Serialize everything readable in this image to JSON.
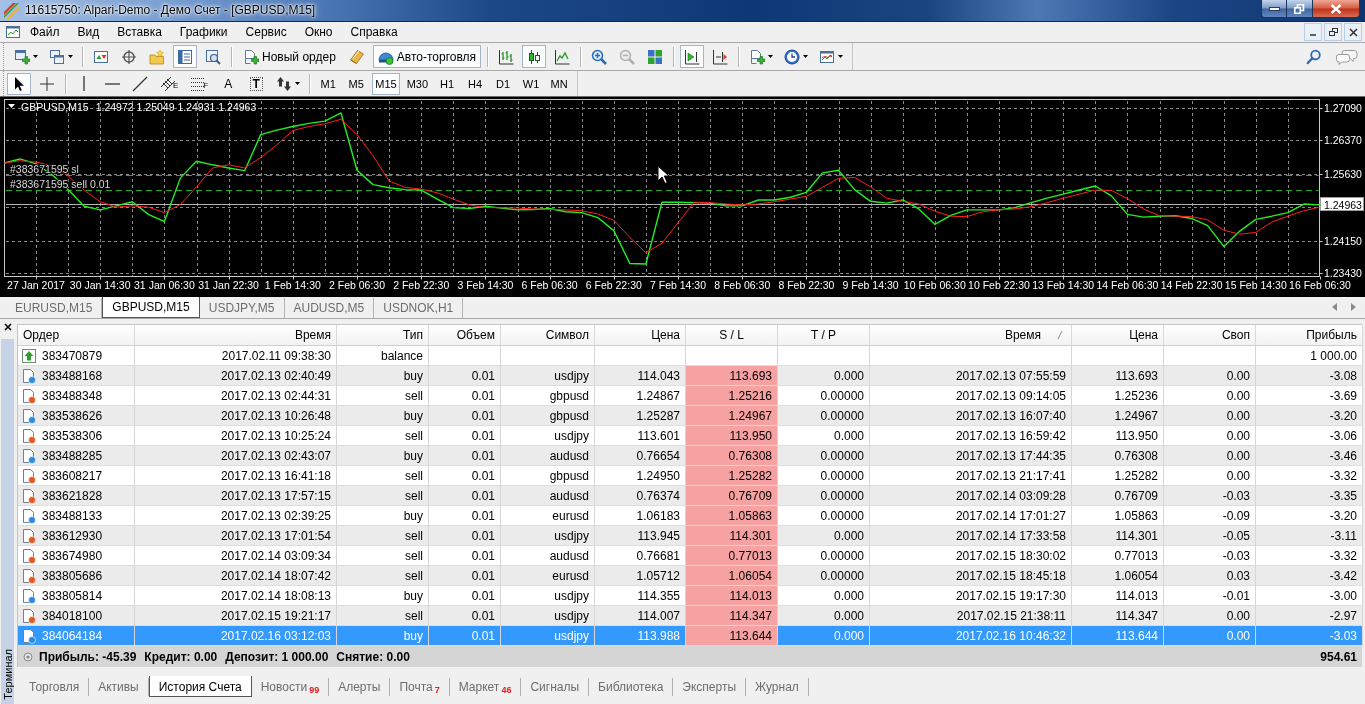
{
  "window": {
    "title": "11615750: Alpari-Demo - Демо Счет - [GBPUSD,M15]"
  },
  "menu": {
    "items": [
      "Файл",
      "Вид",
      "Вставка",
      "Графики",
      "Сервис",
      "Окно",
      "Справка"
    ]
  },
  "toolbar": {
    "groups": [
      [
        {
          "pressed": false,
          "dropdown": true
        },
        {
          "pressed": false,
          "dropdown": true
        }
      ],
      [
        {
          "pressed": false
        },
        {
          "pressed": false
        },
        {
          "pressed": false
        },
        {
          "pressed": true
        },
        {
          "pressed": false
        }
      ],
      [
        {
          "label": "Новый ордер",
          "pressed": false
        },
        {
          "pressed": false
        },
        {
          "label": "Авто-торговля",
          "pressed": true
        }
      ],
      [
        {
          "pressed": false
        },
        {
          "pressed": true
        },
        {
          "pressed": false
        }
      ],
      [
        {
          "pressed": false,
          "disabled": false
        },
        {
          "pressed": false,
          "disabled": true
        },
        {
          "pressed": false,
          "disabled": false
        }
      ],
      [
        {
          "pressed": true
        },
        {
          "pressed": false
        }
      ],
      [
        {
          "pressed": false,
          "dropdown": true
        },
        {
          "pressed": false,
          "dropdown": true
        },
        {
          "pressed": false,
          "dropdown": true
        }
      ]
    ]
  },
  "drawing_toolbar": {
    "groups": [
      [
        {
          "pressed": true
        },
        {
          "pressed": false
        }
      ],
      [
        {
          "pressed": false
        },
        {
          "pressed": false
        },
        {
          "pressed": false
        },
        {
          "pressed": false,
          "glyph": "E"
        },
        {
          "pressed": false,
          "glyph": "F"
        },
        {
          "pressed": false,
          "glyph": "A"
        },
        {
          "pressed": false,
          "glyph": "T"
        },
        {
          "pressed": false,
          "dropdown": true
        }
      ]
    ],
    "timeframes": [
      {
        "label": "M1",
        "selected": false
      },
      {
        "label": "M5",
        "selected": false
      },
      {
        "label": "M15",
        "selected": true
      },
      {
        "label": "M30",
        "selected": false
      },
      {
        "label": "H1",
        "selected": false
      },
      {
        "label": "H4",
        "selected": false
      },
      {
        "label": "D1",
        "selected": false
      },
      {
        "label": "W1",
        "selected": false
      },
      {
        "label": "MN",
        "selected": false
      }
    ]
  },
  "chart": {
    "symbol": "GBPUSD,M15",
    "prices": "1.24972 1.25049 1.24931 1.24963",
    "chart_data": {
      "type": "line",
      "categories": [
        null,
        null,
        "27 Jan 2017",
        null,
        null,
        null,
        "30 Jan 14:30",
        null,
        null,
        null,
        "31 Jan 06:30",
        null,
        null,
        null,
        "31 Jan 22:30",
        null,
        null,
        null,
        "1 Feb 14:30",
        null,
        null,
        null,
        "2 Feb 06:30",
        null,
        null,
        null,
        "2 Feb 22:30",
        null,
        null,
        null,
        "3 Feb 14:30",
        null,
        null,
        null,
        "6 Feb 06:30",
        null,
        null,
        null,
        "6 Feb 22:30",
        null,
        null,
        null,
        "7 Feb 14:30",
        null,
        null,
        null,
        "8 Feb 06:30",
        null,
        null,
        null,
        "8 Feb 22:30",
        null,
        null,
        null,
        "9 Feb 14:30",
        null,
        null,
        null,
        "10 Feb 06:30",
        null,
        null,
        null,
        "10 Feb 22:30",
        null,
        null,
        null,
        "13 Feb 14:30",
        null,
        null,
        null,
        "14 Feb 06:30",
        null,
        null,
        null,
        "14 Feb 22:30",
        null,
        null,
        null,
        "15 Feb 14:30",
        null,
        null,
        null,
        "16 Feb 06:30"
      ],
      "series": [
        {
          "color": "#22ee22",
          "values": [
            1.2587,
            1.2596,
            1.2585,
            1.2561,
            1.2528,
            1.2491,
            1.2483,
            1.2492,
            1.2501,
            1.2473,
            1.2457,
            1.2554,
            1.2591,
            1.2583,
            1.2576,
            1.257,
            1.265,
            1.266,
            1.2668,
            1.2675,
            1.268,
            1.2698,
            1.2571,
            1.2539,
            1.2532,
            1.2528,
            1.2527,
            1.2507,
            1.2488,
            1.2486,
            1.2491,
            1.2487,
            1.2483,
            1.2484,
            1.2486,
            1.2479,
            1.2477,
            1.2466,
            1.2437,
            1.2364,
            1.2363,
            1.25,
            1.25,
            1.2499,
            1.2498,
            1.2492,
            1.2492,
            1.2505,
            1.2505,
            1.2511,
            1.2522,
            1.2565,
            1.2571,
            1.2528,
            1.2502,
            1.2498,
            1.2505,
            1.2485,
            1.2451,
            1.2471,
            1.2483,
            1.2483,
            1.2483,
            1.2488,
            1.2499,
            1.2509,
            1.2518,
            1.2527,
            1.2536,
            1.2514,
            1.2473,
            1.2467,
            1.2469,
            1.247,
            1.2464,
            1.2448,
            1.2402,
            1.2436,
            1.2462,
            1.2469,
            1.2477,
            1.2496,
            1.2494
          ]
        },
        {
          "color": "#ff2020",
          "values": [
            1.2587,
            1.2592,
            1.2589,
            1.2581,
            1.2558,
            1.2527,
            1.2501,
            1.2489,
            1.2492,
            1.2489,
            1.2477,
            1.2495,
            1.2534,
            1.2576,
            1.2583,
            1.2576,
            1.2599,
            1.2627,
            1.2659,
            1.2668,
            1.2674,
            1.2684,
            1.265,
            1.2603,
            1.2547,
            1.2533,
            1.2529,
            1.2521,
            1.2507,
            1.2494,
            1.2488,
            1.2488,
            1.2487,
            1.2485,
            1.2484,
            1.2483,
            1.2481,
            1.2474,
            1.246,
            1.2422,
            1.2388,
            1.2409,
            1.2454,
            1.25,
            1.2499,
            1.2496,
            1.2494,
            1.2496,
            1.2501,
            1.2507,
            1.2513,
            1.2533,
            1.2553,
            1.2555,
            1.2534,
            1.2509,
            1.2502,
            1.2496,
            1.248,
            1.2469,
            1.2468,
            1.2479,
            1.2483,
            1.2485,
            1.249,
            1.2499,
            1.2509,
            1.2518,
            1.2527,
            1.2526,
            1.2508,
            1.2485,
            1.247,
            1.2469,
            1.2468,
            1.2461,
            1.2438,
            1.2429,
            1.2433,
            1.2456,
            1.2469,
            1.2481,
            1.2489
          ]
        }
      ],
      "ylim": [
        1.23352,
        1.27279
      ],
      "yticks": [
        {
          "value": 1.2709,
          "label": "1.27090"
        },
        {
          "value": 1.2637,
          "label": "1.26370"
        },
        {
          "value": 1.2563,
          "label": "1.25630"
        },
        {
          "value": 1.2415,
          "label": "1.24150"
        },
        {
          "value": 1.2343,
          "label": "1.23430"
        }
      ],
      "grid": true,
      "ref_lines": [
        {
          "axis": "y",
          "value": 1.256,
          "label": "#383671595 sl",
          "color": "#e04848",
          "line_style": "dashed"
        },
        {
          "axis": "y",
          "value": 1.2527,
          "label": "#383671595 sell 0.01",
          "color": "#1fae1f",
          "line_style": "dashed"
        },
        {
          "axis": "y",
          "value": 1.24963,
          "label": "1.24963",
          "color": "#b4b4b4",
          "line_style": "solid"
        }
      ]
    }
  },
  "chart_tabs": [
    {
      "label": "EURUSD,M15",
      "selected": false
    },
    {
      "label": "GBPUSD,M15",
      "selected": true
    },
    {
      "label": "USDJPY,M5",
      "selected": false
    },
    {
      "label": "AUDUSD,M5",
      "selected": false
    },
    {
      "label": "USDNOK,H1",
      "selected": false
    }
  ],
  "terminal": {
    "title": "Терминал",
    "columns": [
      {
        "label": "Ордер",
        "sorted": false
      },
      {
        "label": "Время",
        "sorted": false
      },
      {
        "label": "Тип",
        "sorted": false
      },
      {
        "label": "Объем",
        "sorted": false
      },
      {
        "label": "Символ",
        "sorted": false
      },
      {
        "label": "Цена",
        "sorted": false
      },
      {
        "label": "S / L",
        "sorted": false
      },
      {
        "label": "T / P",
        "sorted": false
      },
      {
        "label": "Время",
        "sorted": true
      },
      {
        "label": "Цена",
        "sorted": false
      },
      {
        "label": "Своп",
        "sorted": false
      },
      {
        "label": "Прибыль",
        "sorted": false
      }
    ],
    "rows": [
      {
        "kind": "balance",
        "selected": false,
        "sl_hit": false,
        "order": "383470879",
        "open_time": "2017.02.11 09:38:30",
        "type": "balance",
        "profit": "1 000.00"
      },
      {
        "kind": "buy",
        "selected": false,
        "sl_hit": true,
        "order": "383488168",
        "open_time": "2017.02.13 02:40:49",
        "type": "buy",
        "volume": "0.01",
        "symbol": "usdjpy",
        "open_price": "114.043",
        "sl": "113.693",
        "tp": "0.000",
        "close_time": "2017.02.13 07:55:59",
        "close_price": "113.693",
        "swap": "0.00",
        "profit": "-3.08"
      },
      {
        "kind": "sell",
        "selected": false,
        "sl_hit": true,
        "order": "383488348",
        "open_time": "2017.02.13 02:44:31",
        "type": "sell",
        "volume": "0.01",
        "symbol": "gbpusd",
        "open_price": "1.24867",
        "sl": "1.25216",
        "tp": "0.00000",
        "close_time": "2017.02.13 09:14:05",
        "close_price": "1.25236",
        "swap": "0.00",
        "profit": "-3.69"
      },
      {
        "kind": "buy",
        "selected": false,
        "sl_hit": true,
        "order": "383538626",
        "open_time": "2017.02.13 10:26:48",
        "type": "buy",
        "volume": "0.01",
        "symbol": "gbpusd",
        "open_price": "1.25287",
        "sl": "1.24967",
        "tp": "0.00000",
        "close_time": "2017.02.13 16:07:40",
        "close_price": "1.24967",
        "swap": "0.00",
        "profit": "-3.20"
      },
      {
        "kind": "sell",
        "selected": false,
        "sl_hit": true,
        "order": "383538306",
        "open_time": "2017.02.13 10:25:24",
        "type": "sell",
        "volume": "0.01",
        "symbol": "usdjpy",
        "open_price": "113.601",
        "sl": "113.950",
        "tp": "0.000",
        "close_time": "2017.02.13 16:59:42",
        "close_price": "113.950",
        "swap": "0.00",
        "profit": "-3.06"
      },
      {
        "kind": "buy",
        "selected": false,
        "sl_hit": true,
        "order": "383488285",
        "open_time": "2017.02.13 02:43:07",
        "type": "buy",
        "volume": "0.01",
        "symbol": "audusd",
        "open_price": "0.76654",
        "sl": "0.76308",
        "tp": "0.00000",
        "close_time": "2017.02.13 17:44:35",
        "close_price": "0.76308",
        "swap": "0.00",
        "profit": "-3.46"
      },
      {
        "kind": "sell",
        "selected": false,
        "sl_hit": true,
        "order": "383608217",
        "open_time": "2017.02.13 16:41:18",
        "type": "sell",
        "volume": "0.01",
        "symbol": "gbpusd",
        "open_price": "1.24950",
        "sl": "1.25282",
        "tp": "0.00000",
        "close_time": "2017.02.13 21:17:41",
        "close_price": "1.25282",
        "swap": "0.00",
        "profit": "-3.32"
      },
      {
        "kind": "sell",
        "selected": false,
        "sl_hit": true,
        "order": "383621828",
        "open_time": "2017.02.13 17:57:15",
        "type": "sell",
        "volume": "0.01",
        "symbol": "audusd",
        "open_price": "0.76374",
        "sl": "0.76709",
        "tp": "0.00000",
        "close_time": "2017.02.14 03:09:28",
        "close_price": "0.76709",
        "swap": "-0.03",
        "profit": "-3.35"
      },
      {
        "kind": "buy",
        "selected": false,
        "sl_hit": true,
        "order": "383488133",
        "open_time": "2017.02.13 02:39:25",
        "type": "buy",
        "volume": "0.01",
        "symbol": "eurusd",
        "open_price": "1.06183",
        "sl": "1.05863",
        "tp": "0.00000",
        "close_time": "2017.02.14 17:01:27",
        "close_price": "1.05863",
        "swap": "-0.09",
        "profit": "-3.20"
      },
      {
        "kind": "sell",
        "selected": false,
        "sl_hit": true,
        "order": "383612930",
        "open_time": "2017.02.13 17:01:54",
        "type": "sell",
        "volume": "0.01",
        "symbol": "usdjpy",
        "open_price": "113.945",
        "sl": "114.301",
        "tp": "0.000",
        "close_time": "2017.02.14 17:33:58",
        "close_price": "114.301",
        "swap": "-0.05",
        "profit": "-3.11"
      },
      {
        "kind": "sell",
        "selected": false,
        "sl_hit": true,
        "order": "383674980",
        "open_time": "2017.02.14 03:09:34",
        "type": "sell",
        "volume": "0.01",
        "symbol": "audusd",
        "open_price": "0.76681",
        "sl": "0.77013",
        "tp": "0.00000",
        "close_time": "2017.02.15 18:30:02",
        "close_price": "0.77013",
        "swap": "-0.03",
        "profit": "-3.32"
      },
      {
        "kind": "sell",
        "selected": false,
        "sl_hit": true,
        "order": "383805686",
        "open_time": "2017.02.14 18:07:42",
        "type": "sell",
        "volume": "0.01",
        "symbol": "eurusd",
        "open_price": "1.05712",
        "sl": "1.06054",
        "tp": "0.00000",
        "close_time": "2017.02.15 18:45:18",
        "close_price": "1.06054",
        "swap": "0.03",
        "profit": "-3.42"
      },
      {
        "kind": "buy",
        "selected": false,
        "sl_hit": true,
        "order": "383805814",
        "open_time": "2017.02.14 18:08:13",
        "type": "buy",
        "volume": "0.01",
        "symbol": "usdjpy",
        "open_price": "114.355",
        "sl": "114.013",
        "tp": "0.000",
        "close_time": "2017.02.15 19:17:30",
        "close_price": "114.013",
        "swap": "-0.01",
        "profit": "-3.00"
      },
      {
        "kind": "sell",
        "selected": false,
        "sl_hit": true,
        "order": "384018100",
        "open_time": "2017.02.15 19:21:17",
        "type": "sell",
        "volume": "0.01",
        "symbol": "usdjpy",
        "open_price": "114.007",
        "sl": "114.347",
        "tp": "0.000",
        "close_time": "2017.02.15 21:38:11",
        "close_price": "114.347",
        "swap": "0.00",
        "profit": "-2.97"
      },
      {
        "kind": "buy",
        "selected": true,
        "sl_hit": true,
        "order": "384064184",
        "open_time": "2017.02.16 03:12:03",
        "type": "buy",
        "volume": "0.01",
        "symbol": "usdjpy",
        "open_price": "113.988",
        "sl": "113.644",
        "tp": "0.000",
        "close_time": "2017.02.16 10:46:32",
        "close_price": "113.644",
        "swap": "0.00",
        "profit": "-3.03"
      }
    ],
    "summary": [
      "Прибыль: -45.39",
      "Кредит: 0.00",
      "Депозит: 1 000.00",
      "Снятие: 0.00"
    ],
    "total": "954.61",
    "tabs": [
      {
        "label": "Торговля",
        "selected": false
      },
      {
        "label": "Активы",
        "selected": false
      },
      {
        "label": "История Счета",
        "selected": true
      },
      {
        "label": "Новости",
        "count": "99",
        "selected": false
      },
      {
        "label": "Алерты",
        "selected": false
      },
      {
        "label": "Почта",
        "count": "7",
        "selected": false
      },
      {
        "label": "Маркет",
        "count": "46",
        "selected": false
      },
      {
        "label": "Сигналы",
        "selected": false
      },
      {
        "label": "Библиотека",
        "selected": false
      },
      {
        "label": "Эксперты",
        "selected": false
      },
      {
        "label": "Журнал",
        "selected": false
      }
    ]
  }
}
